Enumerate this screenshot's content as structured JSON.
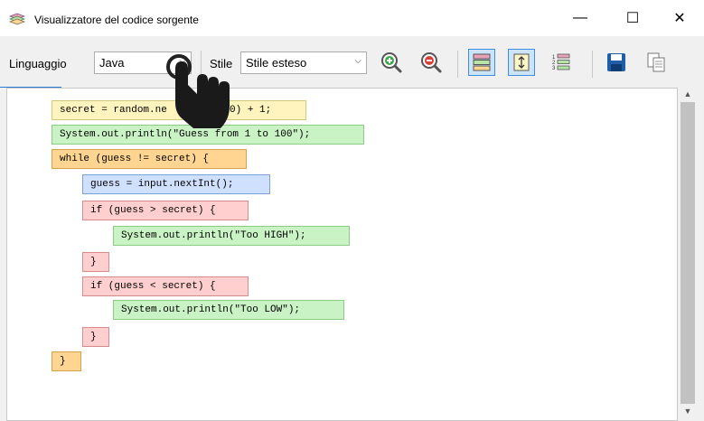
{
  "window": {
    "title": "Visualizzatore del codice sorgente"
  },
  "titlebar_buttons": {
    "minimize": "—",
    "maximize": "☐",
    "close": "✕"
  },
  "toolbar": {
    "language_label": "Linguaggio",
    "language_value": "Java",
    "style_label": "Stile",
    "style_value": "Stile esteso"
  },
  "code_blocks": [
    {
      "text": "secret = random.ne",
      "suffix": "100) + 1;"
    },
    {
      "text": "System.out.println(\"Guess from 1 to 100\");"
    },
    {
      "text": "while (guess != secret) {"
    },
    {
      "text": "guess = input.nextInt();"
    },
    {
      "text": "if (guess > secret) {"
    },
    {
      "text": "System.out.println(\"Too HIGH\");"
    },
    {
      "text": "}"
    },
    {
      "text": "if (guess < secret) {"
    },
    {
      "text": "System.out.println(\"Too LOW\");"
    },
    {
      "text": "}"
    },
    {
      "text": "}"
    }
  ],
  "colors": {
    "assignment": "#fff4be",
    "output": "#c9f3c4",
    "loop": "#ffd591",
    "input": "#cfe0ff",
    "condition": "#ffcfcf",
    "toggle_active": "#cce4f7"
  },
  "icons": {
    "app": "app-logo-icon",
    "zoom_in": "zoom-in-icon",
    "zoom_out": "zoom-out-icon",
    "view_blocks": "block-view-icon",
    "fit": "fit-height-icon",
    "numbered": "numbered-list-icon",
    "save": "save-icon",
    "copy": "copy-icon"
  }
}
